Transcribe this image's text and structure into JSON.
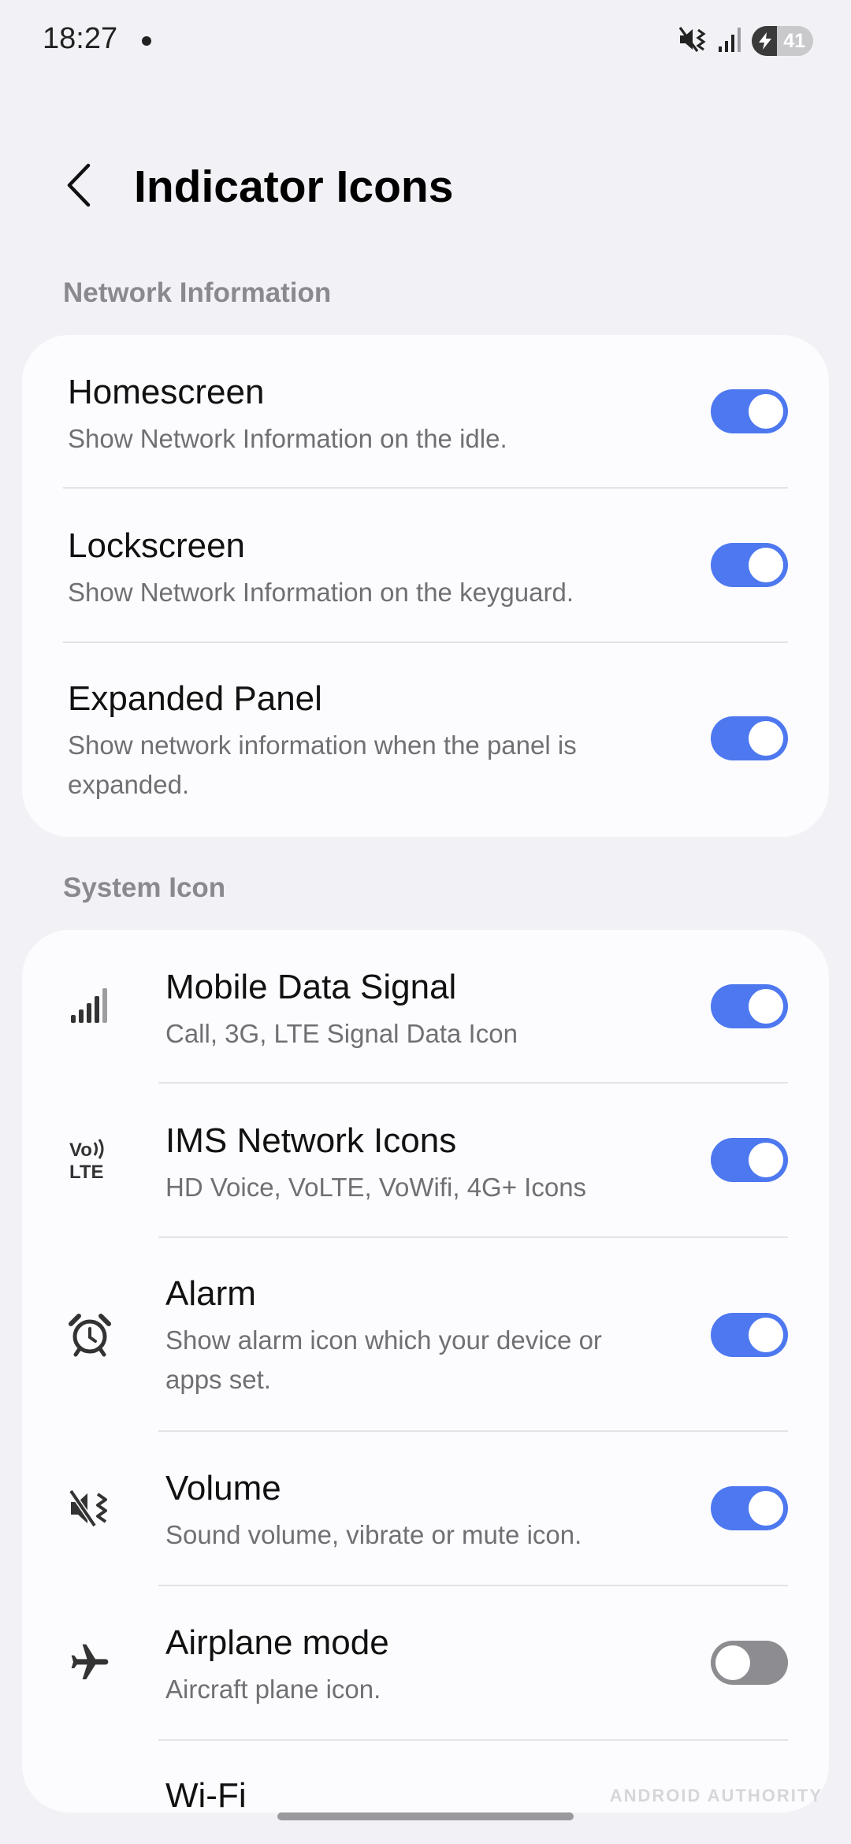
{
  "status_bar": {
    "time": "18:27",
    "battery_level": "41",
    "battery_fraction": 0.41,
    "icons": [
      "notification-dot-icon",
      "mute-vibrate-icon",
      "signal-icon",
      "battery-charging-icon"
    ]
  },
  "header": {
    "title": "Indicator Icons",
    "back_icon": "chevron-left-icon"
  },
  "sections": {
    "network": {
      "title": "Network Information",
      "items": [
        {
          "title": "Homescreen",
          "subtitle": "Show Network Information on the idle.",
          "enabled": true
        },
        {
          "title": "Lockscreen",
          "subtitle": "Show Network Information on the keyguard.",
          "enabled": true
        },
        {
          "title": "Expanded Panel",
          "subtitle_line1": "Show network information when the panel is",
          "subtitle_line2": "expanded.",
          "enabled": true
        }
      ]
    },
    "system": {
      "title": "System Icon",
      "items": [
        {
          "title": "Mobile Data Signal",
          "subtitle": "Call, 3G, LTE Signal Data Icon",
          "icon": "signal-bars-icon",
          "enabled": true
        },
        {
          "title": "IMS Network Icons",
          "subtitle": "HD Voice, VoLTE, VoWifi, 4G+ Icons",
          "icon": "volte-icon",
          "icon_text_top": "Vo",
          "icon_text_bottom": "LTE",
          "enabled": true
        },
        {
          "title": "Alarm",
          "subtitle_line1": "Show alarm icon which your device or",
          "subtitle_line2": "apps set.",
          "icon": "alarm-clock-icon",
          "enabled": true
        },
        {
          "title": "Volume",
          "subtitle": "Sound volume, vibrate or mute icon.",
          "icon": "mute-vibrate-icon",
          "enabled": true
        },
        {
          "title": "Airplane mode",
          "subtitle": "Aircraft plane icon.",
          "icon": "airplane-icon",
          "enabled": false
        },
        {
          "title": "Wi-Fi"
        }
      ]
    }
  },
  "watermark": "ANDROID AUTHORITY",
  "colors": {
    "background": "#f2f2f6",
    "card": "#fcfcfe",
    "toggle_on": "#4d78ef",
    "toggle_off": "#8d8d91",
    "section_title": "#8a8a8e",
    "subtitle": "#707074"
  }
}
